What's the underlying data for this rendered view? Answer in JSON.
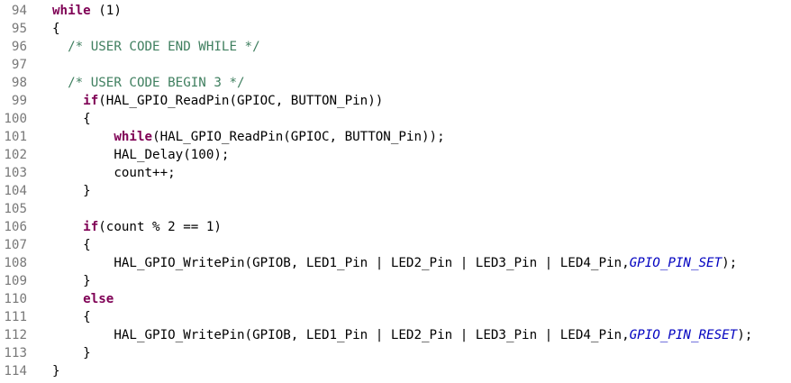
{
  "editor": {
    "lines": [
      {
        "n": "94",
        "segs": [
          {
            "t": "",
            "c": "pl"
          },
          {
            "t": "while",
            "c": "kw"
          },
          {
            "t": " (1)",
            "c": "pl"
          }
        ]
      },
      {
        "n": "95",
        "segs": [
          {
            "t": "{",
            "c": "pl"
          }
        ]
      },
      {
        "n": "96",
        "segs": [
          {
            "t": "  ",
            "c": "pl"
          },
          {
            "t": "/* USER CODE END WHILE */",
            "c": "cm"
          }
        ]
      },
      {
        "n": "97",
        "segs": [
          {
            "t": "",
            "c": "pl"
          }
        ]
      },
      {
        "n": "98",
        "segs": [
          {
            "t": "  ",
            "c": "pl"
          },
          {
            "t": "/* USER CODE BEGIN 3 */",
            "c": "cm"
          }
        ]
      },
      {
        "n": "99",
        "segs": [
          {
            "t": "    ",
            "c": "pl"
          },
          {
            "t": "if",
            "c": "kw"
          },
          {
            "t": "(HAL_GPIO_ReadPin(GPIOC, BUTTON_Pin))",
            "c": "pl"
          }
        ]
      },
      {
        "n": "100",
        "segs": [
          {
            "t": "    {",
            "c": "pl"
          }
        ]
      },
      {
        "n": "101",
        "segs": [
          {
            "t": "        ",
            "c": "pl"
          },
          {
            "t": "while",
            "c": "kw"
          },
          {
            "t": "(HAL_GPIO_ReadPin(GPIOC, BUTTON_Pin));",
            "c": "pl"
          }
        ]
      },
      {
        "n": "102",
        "segs": [
          {
            "t": "        HAL_Delay(100);",
            "c": "pl"
          }
        ]
      },
      {
        "n": "103",
        "segs": [
          {
            "t": "        count++;",
            "c": "pl"
          }
        ]
      },
      {
        "n": "104",
        "segs": [
          {
            "t": "    }",
            "c": "pl"
          }
        ]
      },
      {
        "n": "105",
        "segs": [
          {
            "t": "",
            "c": "pl"
          }
        ]
      },
      {
        "n": "106",
        "segs": [
          {
            "t": "    ",
            "c": "pl"
          },
          {
            "t": "if",
            "c": "kw"
          },
          {
            "t": "(count % 2 == 1)",
            "c": "pl"
          }
        ]
      },
      {
        "n": "107",
        "segs": [
          {
            "t": "    {",
            "c": "pl"
          }
        ]
      },
      {
        "n": "108",
        "segs": [
          {
            "t": "        HAL_GPIO_WritePin(GPIOB, LED1_Pin | LED2_Pin | LED3_Pin | LED4_Pin,",
            "c": "pl"
          },
          {
            "t": "GPIO_PIN_SET",
            "c": "mc"
          },
          {
            "t": ");",
            "c": "pl"
          }
        ]
      },
      {
        "n": "109",
        "segs": [
          {
            "t": "    }",
            "c": "pl"
          }
        ]
      },
      {
        "n": "110",
        "segs": [
          {
            "t": "    ",
            "c": "pl"
          },
          {
            "t": "else",
            "c": "kw"
          }
        ]
      },
      {
        "n": "111",
        "segs": [
          {
            "t": "    {",
            "c": "pl"
          }
        ]
      },
      {
        "n": "112",
        "segs": [
          {
            "t": "        HAL_GPIO_WritePin(GPIOB, LED1_Pin | LED2_Pin | LED3_Pin | LED4_Pin,",
            "c": "pl"
          },
          {
            "t": "GPIO_PIN_RESET",
            "c": "mc"
          },
          {
            "t": ");",
            "c": "pl"
          }
        ]
      },
      {
        "n": "113",
        "segs": [
          {
            "t": "    }",
            "c": "pl"
          }
        ]
      },
      {
        "n": "114",
        "segs": [
          {
            "t": "}",
            "c": "pl"
          }
        ]
      }
    ]
  },
  "colors": {
    "keyword": "#7f0055",
    "comment": "#3f7f5f",
    "macro": "#0000c0",
    "line_number": "#787878",
    "text": "#000000",
    "background": "#ffffff"
  }
}
